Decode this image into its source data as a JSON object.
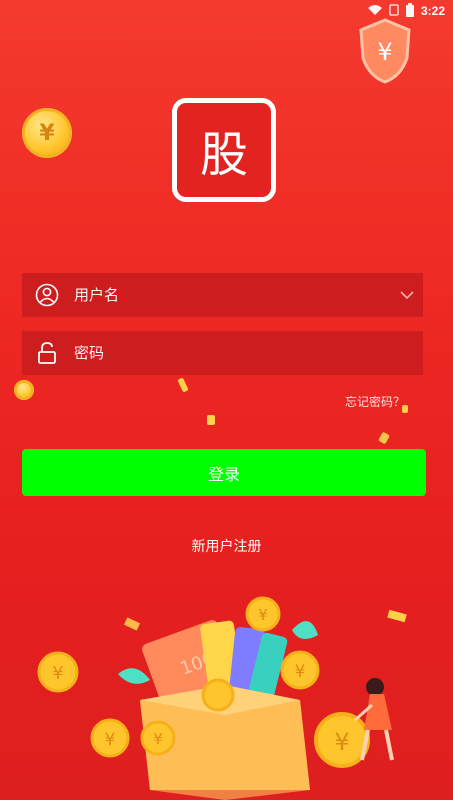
{
  "status": {
    "time": "3:22",
    "wifi_icon": "wifi-icon",
    "battery_icon": "battery-icon"
  },
  "logo": {
    "char": "股"
  },
  "form": {
    "username_placeholder": "用户名",
    "password_placeholder": "密码",
    "forgot_label": "忘记密码？",
    "login_label": "登录",
    "register_label": "新用户注册"
  },
  "colors": {
    "background": "#ee2a24",
    "field_bg": "#cd1d1e",
    "login_button": "#00ff00"
  }
}
